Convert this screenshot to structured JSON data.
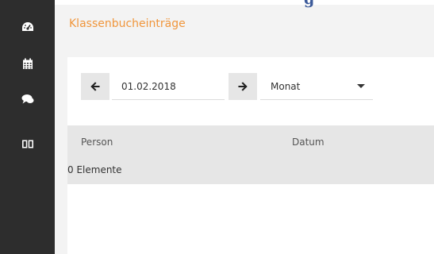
{
  "header": {
    "title": "Klassenbucheinträge",
    "top_text_fragment": "g"
  },
  "sidebar": {
    "items": [
      {
        "icon": "dashboard-icon"
      },
      {
        "icon": "calendar-icon"
      },
      {
        "icon": "comments-icon"
      },
      {
        "icon": "book-icon"
      }
    ]
  },
  "filter": {
    "prev_icon": "arrow-left-icon",
    "date_value": "01.02.2018",
    "next_icon": "arrow-right-icon",
    "period_value": "Monat",
    "period_icon": "caret-down-icon"
  },
  "table": {
    "columns": [
      "Person",
      "Datum"
    ],
    "count_text": "0 Elemente"
  },
  "colors": {
    "sidebar": "#2d2d2d",
    "title": "#f0963c",
    "background": "#f3f3f3",
    "header_row": "#e6e6e6"
  }
}
